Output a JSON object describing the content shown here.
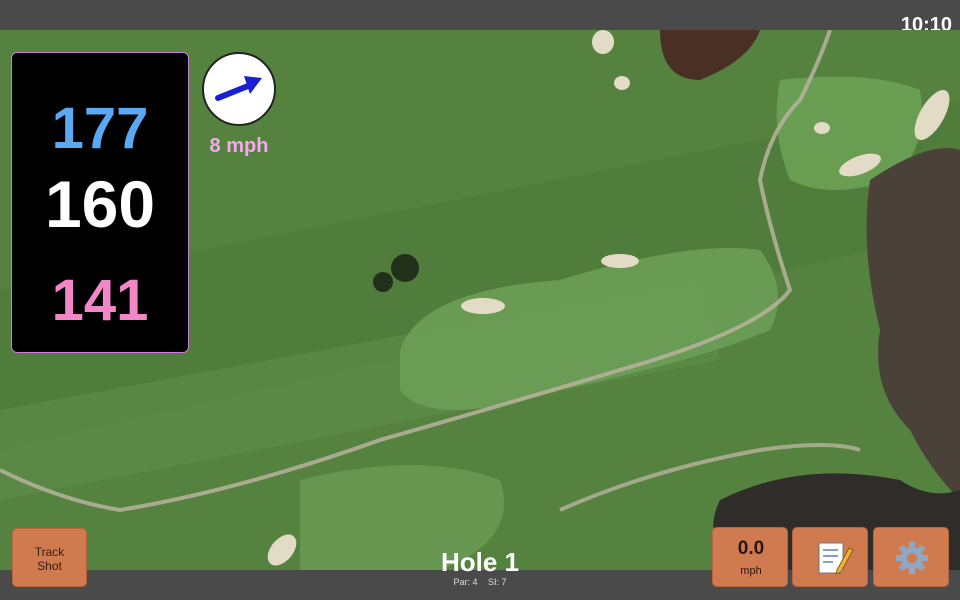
{
  "status": {
    "time": "10:10"
  },
  "distances": {
    "back": "177",
    "middle": "160",
    "front": "141"
  },
  "wind": {
    "speed": "8 mph",
    "direction_icon": "arrow-icon"
  },
  "buttons": {
    "track_shot_line1": "Track",
    "track_shot_line2": "Shot",
    "speed_value": "0.0",
    "speed_unit": "mph",
    "notes_icon": "notes-icon",
    "settings_icon": "gear-icon"
  },
  "hole": {
    "title": "Hole 1",
    "par": "Par: 4",
    "si": "SI: 7"
  },
  "colors": {
    "back": "#5aa9f2",
    "middle": "#ffffff",
    "front": "#f287c8",
    "button": "#cf7a4f",
    "wind_text": "#f6a8ef"
  }
}
